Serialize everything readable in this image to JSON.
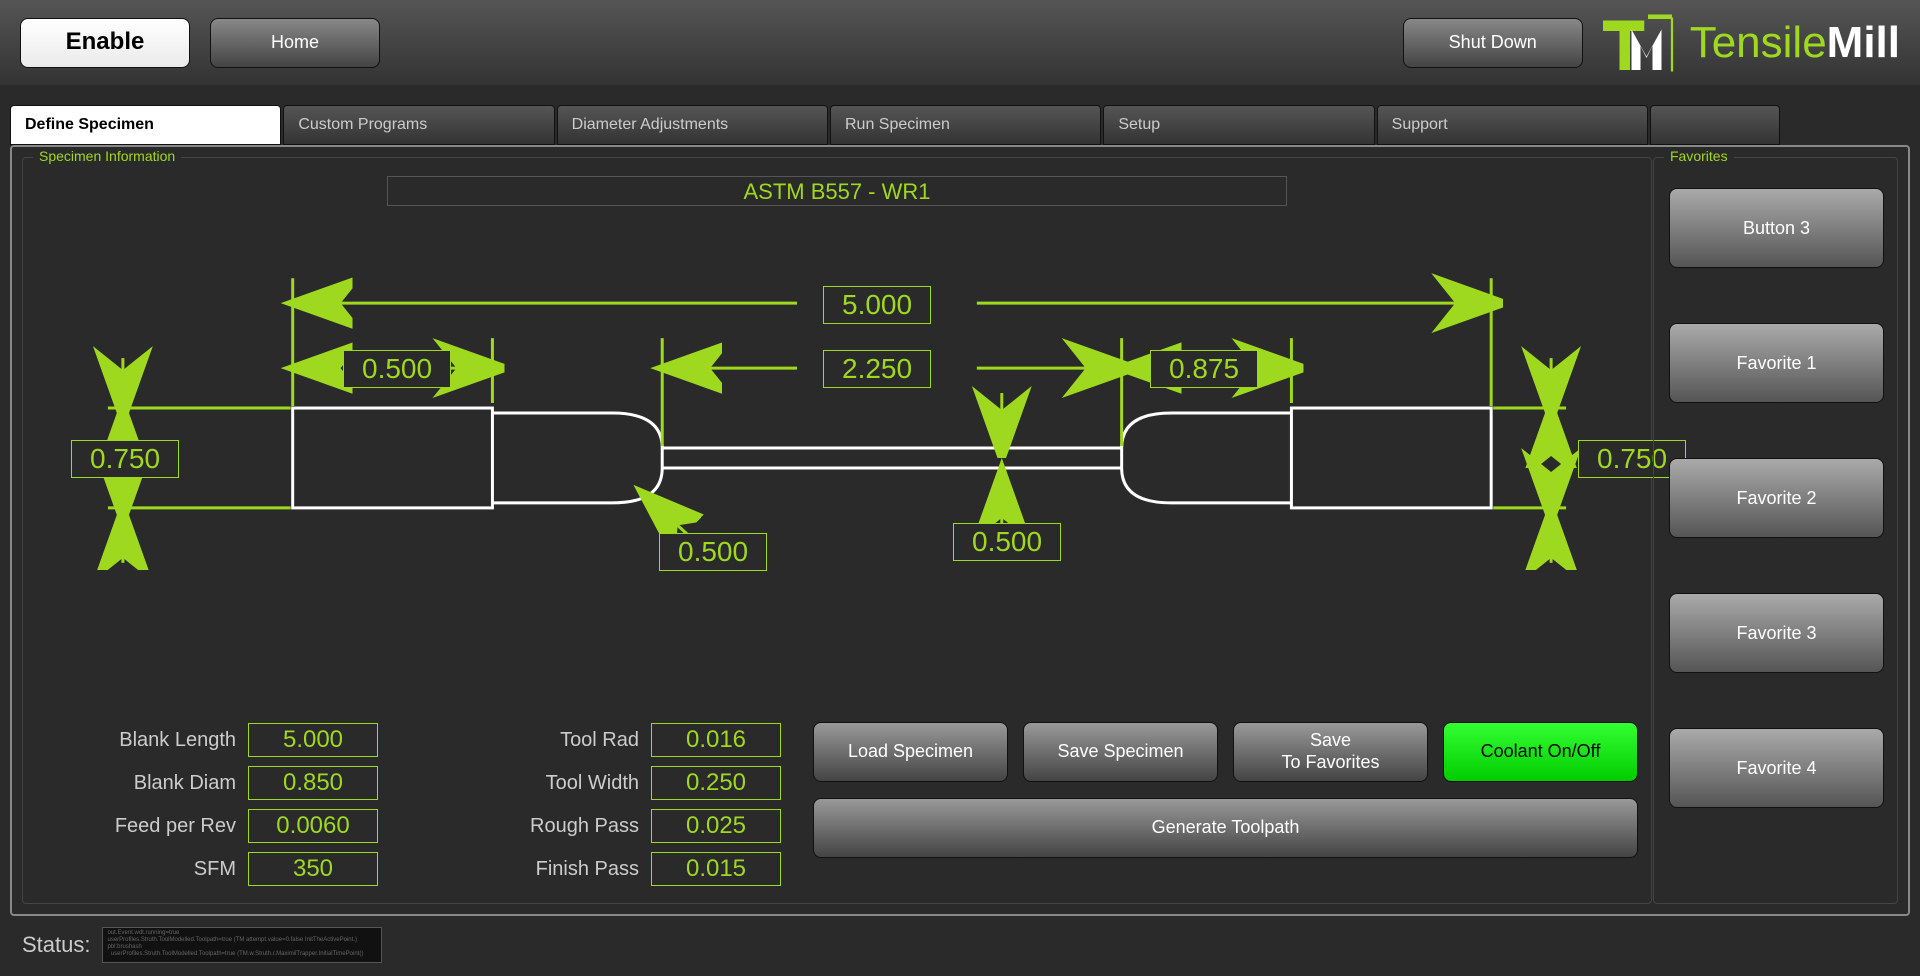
{
  "topbar": {
    "enable": "Enable",
    "home": "Home",
    "shutdown": "Shut Down",
    "logo_tensile": "Tensile",
    "logo_mill": "Mill"
  },
  "tabs": {
    "define": "Define Specimen",
    "custom": "Custom Programs",
    "diameter": "Diameter Adjustments",
    "run": "Run Specimen",
    "setup": "Setup",
    "support": "Support"
  },
  "specimen": {
    "legend": "Specimen Information",
    "name": "ASTM B557 - WR1",
    "dims": {
      "overall_length": "5.000",
      "grip_width_left": "0.500",
      "gage_length": "2.250",
      "grip_width_right": "0.875",
      "height_left": "0.750",
      "height_right": "0.750",
      "fillet_rad": "0.500",
      "reduced_width": "0.500"
    },
    "params": {
      "blank_length_label": "Blank Length",
      "blank_length": "5.000",
      "blank_diam_label": "Blank Diam",
      "blank_diam": "0.850",
      "feed_label": "Feed per Rev",
      "feed": "0.0060",
      "sfm_label": "SFM",
      "sfm": "350",
      "tool_rad_label": "Tool Rad",
      "tool_rad": "0.016",
      "tool_width_label": "Tool Width",
      "tool_width": "0.250",
      "rough_label": "Rough Pass",
      "rough": "0.025",
      "finish_label": "Finish Pass",
      "finish": "0.015"
    },
    "actions": {
      "load": "Load Specimen",
      "save": "Save Specimen",
      "save_fav": "Save\nTo Favorites",
      "coolant": "Coolant On/Off",
      "generate": "Generate Toolpath"
    }
  },
  "favorites": {
    "legend": "Favorites",
    "items": [
      "Button 3",
      "Favorite 1",
      "Favorite 2",
      "Favorite 3",
      "Favorite 4"
    ]
  },
  "status": {
    "label": "Status:",
    "log": "out.Event.wdt.running=true\nuserProfiles.Struth.ToolModelled.Toolpath=true (TM attempt.value=0.false InitTheActivePoint.)\npbl:brushash\n  userProfiles.Struth.ToolModelled.Toolpath=true (TM.w.Struth.r.MaximilTrapper.InitialTimePoint()"
  }
}
